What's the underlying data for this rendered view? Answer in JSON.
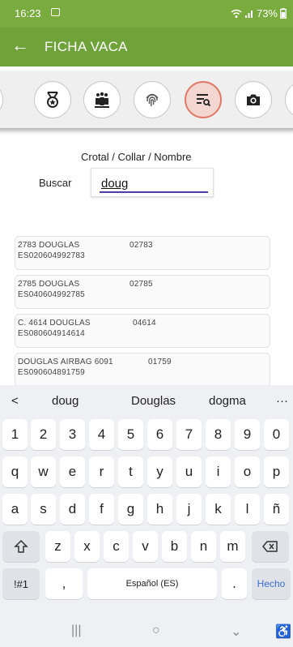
{
  "status_bar": {
    "time": "16:23",
    "battery": "73%",
    "icons": [
      "gallery-icon",
      "wifi-icon",
      "signal-icon",
      "battery-icon"
    ]
  },
  "app_bar": {
    "back_icon": "arrow-left-icon",
    "title": "FICHA VACA"
  },
  "tabs": [
    {
      "icon": "medal-icon",
      "active": false
    },
    {
      "icon": "herd-icon",
      "active": false
    },
    {
      "icon": "fingerprint-icon",
      "active": false
    },
    {
      "icon": "search-list-icon",
      "active": true
    },
    {
      "icon": "camera-icon",
      "active": false
    }
  ],
  "search": {
    "hint": "Crotal / Collar / Nombre",
    "label": "Buscar",
    "value": "doug"
  },
  "results": [
    {
      "name": "2783 DOUGLAS",
      "code": "02783",
      "ear_tag": "ES020604992783"
    },
    {
      "name": "2785 DOUGLAS",
      "code": "02785",
      "ear_tag": "ES040604992785"
    },
    {
      "name": "C. 4614 DOUGLAS",
      "code": "04614",
      "ear_tag": "ES080604914614"
    },
    {
      "name": "DOUGLAS AIRBAG 6091",
      "code": "01759",
      "ear_tag": "ES090604891759"
    }
  ],
  "keyboard": {
    "suggestions": [
      "doug",
      "Douglas",
      "dogma"
    ],
    "suggest_back": "<",
    "suggest_more": "···",
    "row_numbers": [
      "1",
      "2",
      "3",
      "4",
      "5",
      "6",
      "7",
      "8",
      "9",
      "0"
    ],
    "row_1": [
      "q",
      "w",
      "e",
      "r",
      "t",
      "y",
      "u",
      "i",
      "o",
      "p"
    ],
    "row_2": [
      "a",
      "s",
      "d",
      "f",
      "g",
      "h",
      "j",
      "k",
      "l",
      "ñ"
    ],
    "row_3": [
      "z",
      "x",
      "c",
      "v",
      "b",
      "n",
      "m"
    ],
    "symbols": "!#1",
    "comma": ",",
    "space": "Español (ES)",
    "period": ".",
    "done": "Hecho"
  },
  "nav_bar": {
    "recents": "|||",
    "home": "○",
    "back": "⌄",
    "accessibility": "♿"
  },
  "colors": {
    "app_bar": "#6fa33a",
    "status_bar": "#7aab3f",
    "active_tab_border": "#e07a66",
    "input_underline": "#4b3aa8"
  }
}
